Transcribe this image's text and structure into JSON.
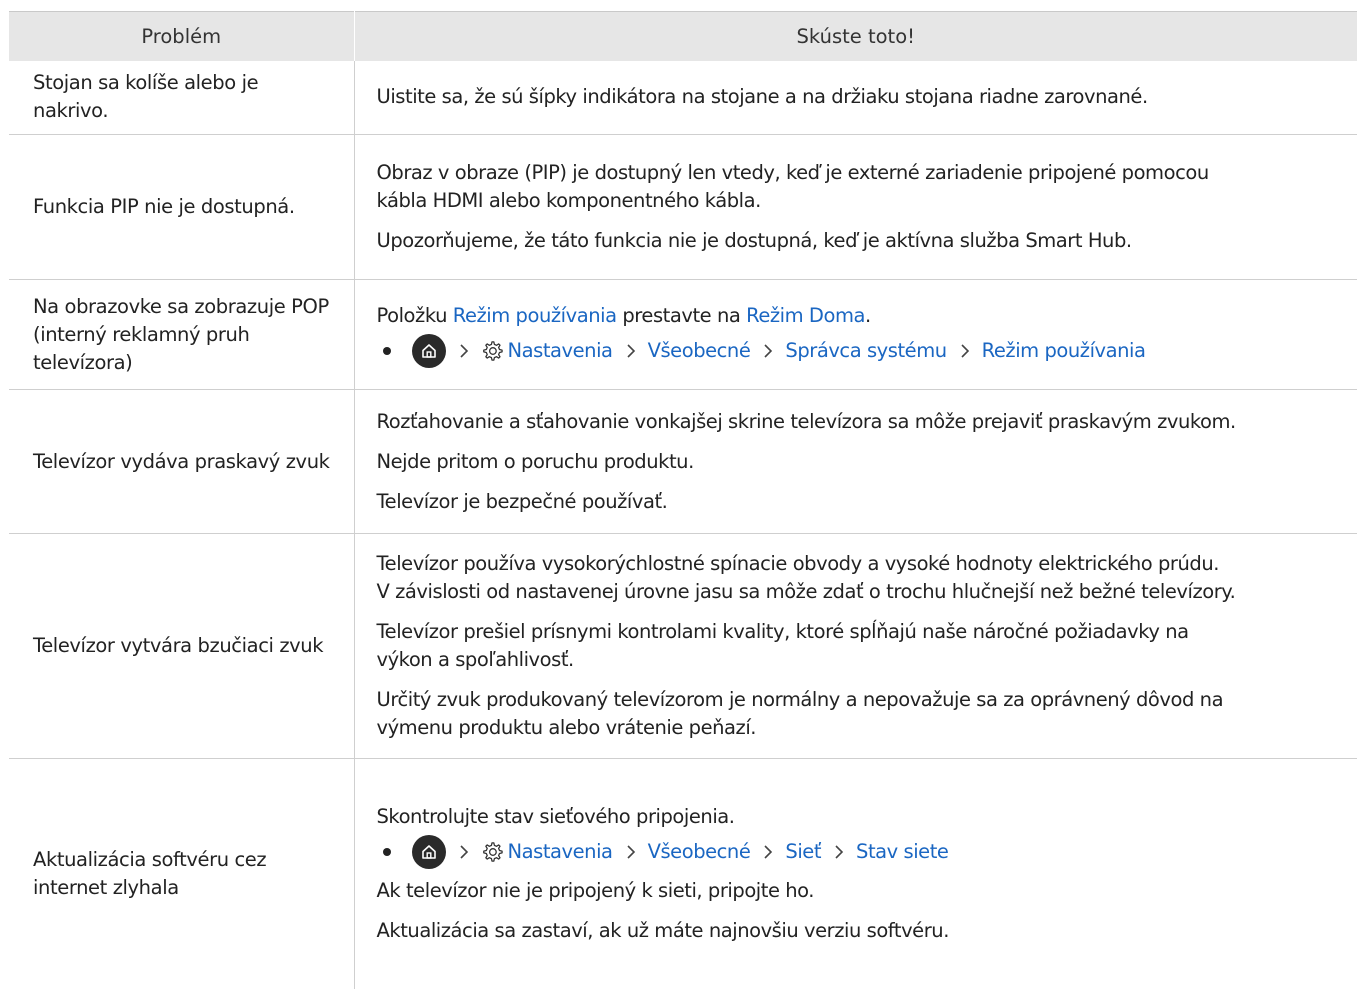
{
  "header": {
    "col_problem": "Problém",
    "col_solution": "Skúste toto!"
  },
  "rows": [
    {
      "problem": "Stojan sa kolíše alebo je nakrivo.",
      "paragraphs": [
        "Uistite sa, že sú šípky indikátora na stojane a na držiaku stojana riadne zarovnané."
      ]
    },
    {
      "problem": "Funkcia PIP nie je dostupná.",
      "paragraphs": [
        "Obraz v obraze (PIP) je dostupný len vtedy, keď je externé zariadenie pripojené pomocou",
        "kábla HDMI alebo komponentného kábla.",
        "Upozorňujeme, že táto funkcia nie je dostupná, keď je aktívna služba Smart Hub."
      ]
    },
    {
      "problem": "Na obrazovke sa zobrazuje POP (interný reklamný pruh televízora)",
      "intro": {
        "t1": "Položku ",
        "link1": "Režim používania",
        "t2": " prestavte na ",
        "link2": "Režim Doma",
        "t3": "."
      },
      "path": [
        "Nastavenia",
        "Všeobecné",
        "Správca systému",
        "Režim používania"
      ]
    },
    {
      "problem": "Televízor vydáva praskavý zvuk",
      "paragraphs": [
        "Rozťahovanie a sťahovanie vonkajšej skrine televízora sa môže prejaviť praskavým zvukom.",
        "Nejde pritom o poruchu produktu.",
        "Televízor je bezpečné používať."
      ]
    },
    {
      "problem": "Televízor vytvára bzučiaci zvuk",
      "paragraphs": [
        "Televízor používa vysokorýchlostné spínacie obvody a vysoké hodnoty elektrického prúdu.",
        "V závislosti od nastavenej úrovne jasu sa môže zdať o trochu hlučnejší než bežné televízory.",
        "Televízor prešiel prísnymi kontrolami kvality, ktoré spĺňajú naše náročné požiadavky na",
        "výkon a spoľahlivosť.",
        "Určitý zvuk produkovaný televízorom je normálny a nepovažuje sa za oprávnený dôvod na",
        "výmenu produktu alebo vrátenie peňazí."
      ]
    },
    {
      "problem": "Aktualizácia softvéru cez internet zlyhala",
      "before": "Skontrolujte stav sieťového pripojenia.",
      "path": [
        "Nastavenia",
        "Všeobecné",
        "Sieť",
        "Stav siete"
      ],
      "after": [
        "Ak televízor nie je pripojený k sieti, pripojte ho.",
        "Aktualizácia sa zastaví, ak už máte najnovšiu verziu softvéru."
      ]
    }
  ],
  "colors": {
    "link": "#1a66c2",
    "header_bg": "#e6e6e6",
    "border": "#cfcfcf",
    "text": "#222222"
  },
  "icons": {
    "home": "home-icon",
    "settings": "gear-icon",
    "separator": "chevron-right-icon"
  }
}
